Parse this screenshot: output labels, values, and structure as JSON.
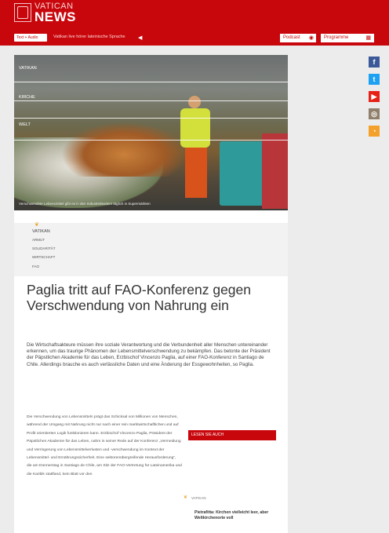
{
  "header": {
    "logo_line1": "VATICAN",
    "logo_line2": "NEWS",
    "language_select": "Text + Audio",
    "live_text": "Vatikan live hörer lateinische Sprache",
    "play_icon": "play-icon",
    "podcast_label": "Podcast",
    "program_label": "Programme",
    "brand_color": "#c8070d"
  },
  "hero": {
    "nav": [
      "VATIKAN",
      "KIRCHE",
      "WELT"
    ],
    "caption": "Verschwendete Lebensmittel gibt es in den Industrieländern täglich in Supermärkten"
  },
  "tags": {
    "main": "VATIKAN",
    "items": [
      "ARMUT",
      "SOLIDARITÄT",
      "WIRTSCHAFT",
      "FAO"
    ]
  },
  "article": {
    "title": "Paglia tritt auf FAO-Konferenz gegen Verschwendung von Nahrung ein",
    "lead": "Die Wirtschaftsakteure müssen ihre soziale Verantwortung und die Verbundenheit aller Menschen untereinander erkennen, um das traurige Phänomen der Lebensmittelverschwendung zu bekämpfen. Das betonte der Präsident der Päpstlichen Akademie für das Leben, Erzbischof Vincenzo Paglia, auf einer FAO-Konferenz in Santiago de Chile. Allerdings brauche es auch verlässliche Daten und eine Änderung der Essgewohnheiten, so Paglia.",
    "body": "Die Verschwendung von Lebensmitteln prägt das Schicksal von Millionen von Menschen, während der Umgang mit Nahrung nicht nur nach einer rein marktwirtschaftlichen und auf Profit orientierten Logik funktionieren kann. Erzbischof Vincenzo Paglia, Präsident der Päpstlichen Akademie für das Leben, nahm in seiner Rede auf der Konferenz „Vermeidung und Verringerung von Lebensmittelverlusten und -verschwendung im Kontext der Lebensmittel- und Ernährungssicherheit. Eine sektorenübergreifende Herausforderung“, die am Donnerstag in Santiago de Chile, am Sitz der FAO-Vertretung für Lateinamerika und die Karibik stattfand, kein Blatt vor den"
  },
  "sidebar": {
    "read_also": "LESEN SIE AUCH",
    "tag": "VATIKAN",
    "teaser_title": "Pietrafitta: Kirchen vielleicht leer, aber Weltkirchenorte voll"
  },
  "social": [
    {
      "icon": "facebook-icon",
      "glyph": "f",
      "color": "#3b5998"
    },
    {
      "icon": "twitter-icon",
      "glyph": "t",
      "color": "#1da1f2"
    },
    {
      "icon": "youtube-icon",
      "glyph": "▶",
      "color": "#e62117"
    },
    {
      "icon": "instagram-icon",
      "glyph": "◎",
      "color": "#8f7f6b"
    },
    {
      "icon": "rss-icon",
      "glyph": "◔",
      "color": "#f4a12b"
    }
  ]
}
